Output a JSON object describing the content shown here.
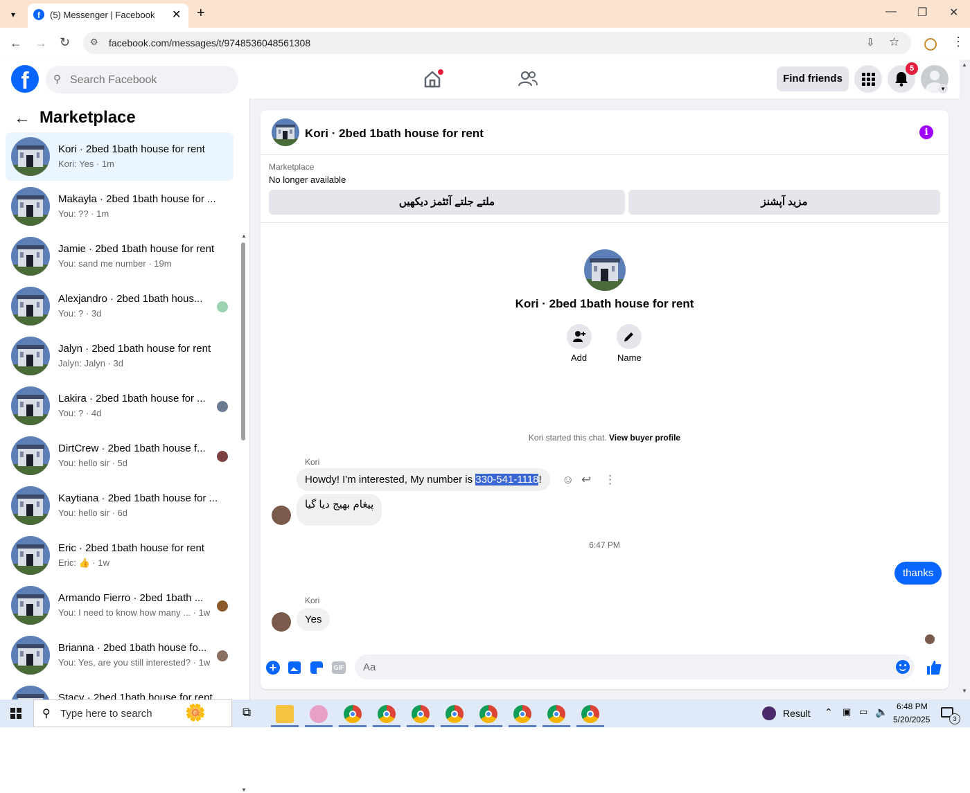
{
  "browser": {
    "tab_title": "(5) Messenger | Facebook",
    "url": "facebook.com/messages/t/9748536048561308"
  },
  "header": {
    "search_placeholder": "Search Facebook",
    "find_friends": "Find friends",
    "notification_count": "5"
  },
  "sidebar": {
    "title": "Marketplace",
    "conversations": [
      {
        "name": "Kori · 2bed 1bath house for rent",
        "sub": "Kori: Yes · 1m",
        "active": true
      },
      {
        "name": "Makayla · 2bed 1bath house for ...",
        "sub": "You: ?? · 1m"
      },
      {
        "name": "Jamie · 2bed 1bath house for rent",
        "sub": "You: sand me number · 19m"
      },
      {
        "name": "Alexjandro · 2bed 1bath hous...",
        "sub": "You: ? · 3d"
      },
      {
        "name": "Jalyn · 2bed 1bath house for rent",
        "sub": "Jalyn: Jalyn · 3d"
      },
      {
        "name": "Lakira · 2bed 1bath house for ...",
        "sub": "You: ? · 4d"
      },
      {
        "name": "DirtCrew · 2bed 1bath house f...",
        "sub": "You: hello sir · 5d"
      },
      {
        "name": "Kaytiana · 2bed 1bath house for ...",
        "sub": "You: hello sir · 6d"
      },
      {
        "name": "Eric · 2bed 1bath house for rent",
        "sub": "Eric: 👍 · 1w"
      },
      {
        "name": "Armando Fierro · 2bed 1bath ...",
        "sub": "You: I need to know how many ...  · 1w"
      },
      {
        "name": "Brianna · 2bed 1bath house fo...",
        "sub": "You: Yes, are you still interested? · 1w"
      },
      {
        "name": "Stacy · 2bed 1bath house for rent",
        "sub": ""
      }
    ]
  },
  "chat": {
    "title": "Kori · 2bed 1bath house for rent",
    "marketplace_label": "Marketplace",
    "listing_status": "No longer available",
    "button_similar": "ملتے جلتے آئٹمز دیکھیں",
    "button_more": "مزید آپشنز",
    "profile_name": "Kori · 2bed 1bath house for rent",
    "add_label": "Add",
    "name_label": "Name",
    "started_text": "Kori started this chat.",
    "view_buyer": "View buyer profile",
    "sender_name": "Kori",
    "msg1_prefix": "Howdy!  I'm interested, My number is ",
    "msg1_number": "330-541-1118",
    "msg1_suffix": "!",
    "msg2": "پیغام بھیج دیا گیا",
    "timestamp": "6:47 PM",
    "my_msg": "thanks",
    "sender_name2": "Kori",
    "msg3": "Yes",
    "composer_placeholder": "Aa"
  },
  "taskbar": {
    "search_placeholder": "Type here to search",
    "weather": "Result",
    "time": "6:48 PM",
    "date": "5/20/2025",
    "notif_count": "3"
  }
}
